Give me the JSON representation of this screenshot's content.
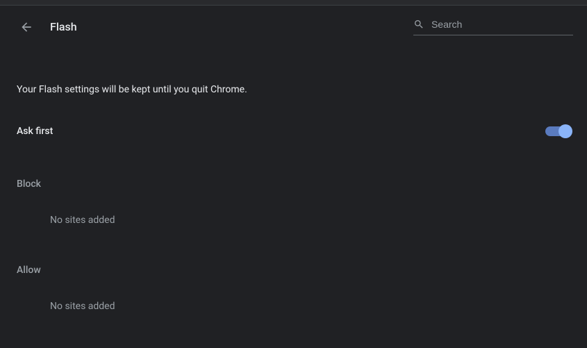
{
  "header": {
    "title": "Flash",
    "search_placeholder": "Search"
  },
  "info_text": "Your Flash settings will be kept until you quit Chrome.",
  "toggle": {
    "label": "Ask first",
    "on": true
  },
  "sections": {
    "block": {
      "title": "Block",
      "empty": "No sites added"
    },
    "allow": {
      "title": "Allow",
      "empty": "No sites added"
    }
  }
}
